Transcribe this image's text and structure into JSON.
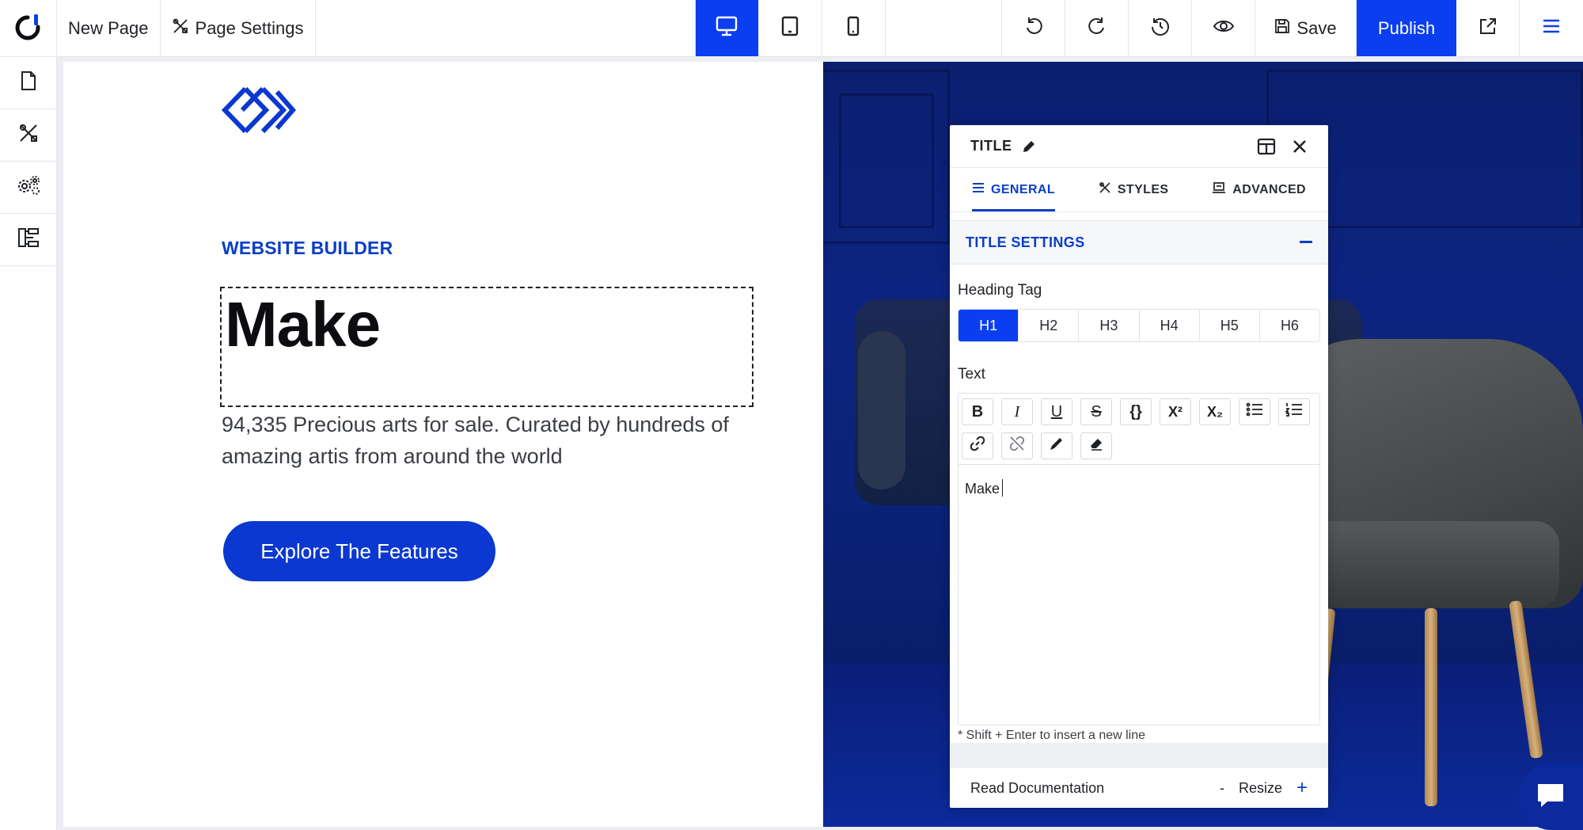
{
  "topbar": {
    "page_name": "New Page",
    "page_settings": "Page Settings",
    "save_label": "Save",
    "publish_label": "Publish"
  },
  "colors": {
    "accent": "#0a3ef0",
    "brand_text": "#0a3ec8"
  },
  "icons": {
    "logo": "brand-logo-icon",
    "devices": [
      "desktop-icon",
      "tablet-icon",
      "mobile-icon"
    ],
    "actions": [
      "undo-icon",
      "redo-icon",
      "history-icon",
      "preview-eye-icon"
    ],
    "rail": [
      "page-icon",
      "design-tools-icon",
      "settings-gears-icon",
      "navigator-tree-icon"
    ]
  },
  "page": {
    "eyebrow": "WEBSITE BUILDER",
    "title": "Make",
    "subtext": "94,335 Precious arts for sale. Curated by hundreds of amazing artis from around the world",
    "cta_label": "Explore The Features"
  },
  "panel": {
    "title": "TITLE",
    "tabs": [
      {
        "label": "GENERAL",
        "active": true
      },
      {
        "label": "STYLES",
        "active": false
      },
      {
        "label": "ADVANCED",
        "active": false
      }
    ],
    "section_title": "TITLE SETTINGS",
    "heading_tag_label": "Heading Tag",
    "heading_tags": [
      "H1",
      "H2",
      "H3",
      "H4",
      "H5",
      "H6"
    ],
    "selected_tag": "H1",
    "text_label": "Text",
    "editor_text": "Make",
    "hint": "* Shift + Enter to insert a new line",
    "read_docs": "Read Documentation",
    "resize_label": "Resize",
    "resize_minus": "-",
    "resize_plus": "+"
  },
  "editor_toolbar": {
    "bold": "B",
    "italic": "I",
    "underline": "U",
    "strike": "S",
    "code": "{}",
    "superscript": "X²",
    "subscript": "X₂"
  }
}
